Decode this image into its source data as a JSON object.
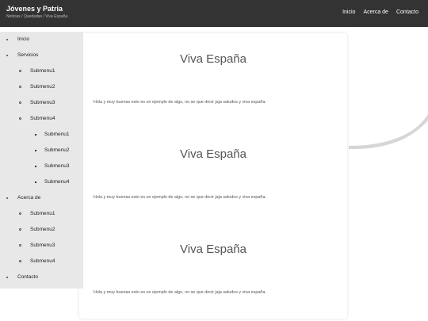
{
  "header": {
    "title": "Jóvenes y Patria",
    "breadcrumb": "Noticias / Quedadas / Viva España",
    "nav": [
      "Inicio",
      "Acerca de",
      "Contacto"
    ]
  },
  "sidebar": {
    "items": [
      {
        "label": "Inicio",
        "level": 0
      },
      {
        "label": "Servicios",
        "level": 0
      },
      {
        "label": "Submenu1",
        "level": 1
      },
      {
        "label": "Submenu2",
        "level": 1
      },
      {
        "label": "Submenu3",
        "level": 1
      },
      {
        "label": "Submenu4",
        "level": 1
      },
      {
        "label": "Submenu1",
        "level": 2
      },
      {
        "label": "Submenu2",
        "level": 2
      },
      {
        "label": "Submenu3",
        "level": 2
      },
      {
        "label": "Submenu4",
        "level": 2
      },
      {
        "label": "Acerca de",
        "level": 0
      },
      {
        "label": "Submenu1",
        "level": 1
      },
      {
        "label": "Submenu2",
        "level": 1
      },
      {
        "label": "Submenu3",
        "level": 1
      },
      {
        "label": "Submenu4",
        "level": 1
      },
      {
        "label": "Contacto",
        "level": 0
      }
    ]
  },
  "posts": [
    {
      "title": "Viva España",
      "body": "Hola y muy buenas esto es un ejemplo de algo, no se que decir jaja saludos y viva españa."
    },
    {
      "title": "Viva España",
      "body": "Hola y muy buenas esto es un ejemplo de algo, no se que decir jaja saludos y viva españa."
    },
    {
      "title": "Viva España",
      "body": "Hola y muy buenas esto es un ejemplo de algo, no se que decir jaja saludos y viva españa."
    }
  ],
  "colors": {
    "header_bg": "#333333",
    "sidebar_bg": "#e8e8e8",
    "swoosh": "#cfcfcf"
  }
}
